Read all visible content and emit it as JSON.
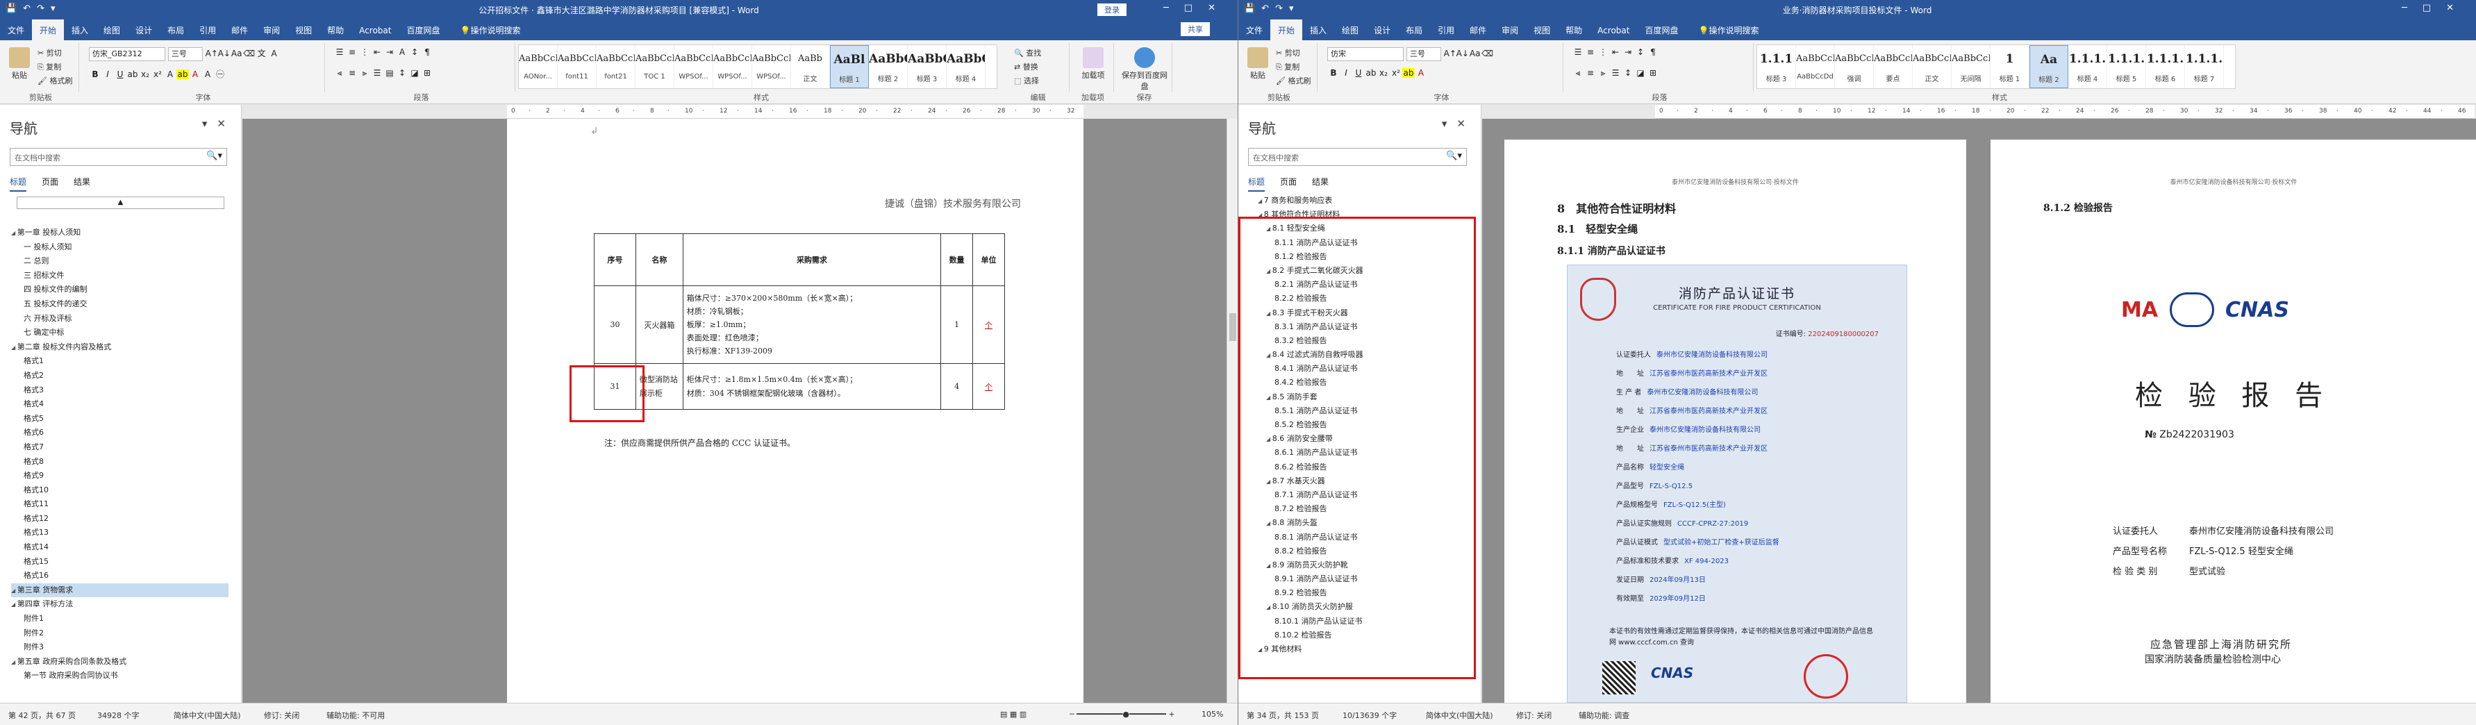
{
  "left": {
    "title": "公开招标文件 · 鑫锋市大洼区潞路中学消防器材采购项目 [兼容模式] - Word",
    "login": "登录",
    "tabs": [
      "文件",
      "开始",
      "插入",
      "绘图",
      "设计",
      "布局",
      "引用",
      "邮件",
      "审阅",
      "视图",
      "帮助",
      "Acrobat",
      "百度网盘"
    ],
    "tell_me": "操作说明搜索",
    "share": "共享",
    "font_name": "仿宋_GB2312",
    "font_size": "三号",
    "paste_label": "粘贴",
    "cut": "剪切",
    "copy": "复制",
    "format_painter": "格式刷",
    "group_clipboard": "剪贴板",
    "group_font": "字体",
    "group_paragraph": "段落",
    "group_styles": "样式",
    "group_edit": "编辑",
    "group_addin": "加载项",
    "group_save": "保存",
    "find": "查找",
    "replace": "替换",
    "select": "选择",
    "acrobat_sign": "加载项",
    "save_baidu": "保存到百度网盘",
    "styles": [
      {
        "pv": "AaBbCcDd",
        "nm": "AONor..."
      },
      {
        "pv": "AaBbCcDd",
        "nm": "font11"
      },
      {
        "pv": "AaBbCcDd",
        "nm": "font21"
      },
      {
        "pv": "AaBbCcDd",
        "nm": "TOC 1"
      },
      {
        "pv": "AaBbCcDd",
        "nm": "WPSOf..."
      },
      {
        "pv": "AaBbCcDd",
        "nm": "WPSOf..."
      },
      {
        "pv": "AaBbCcDd",
        "nm": "WPSOf..."
      },
      {
        "pv": "AaBb",
        "nm": "正文"
      },
      {
        "pv": "AaBl",
        "nm": "标题 1"
      },
      {
        "pv": "AaBbC",
        "nm": "标题 2"
      },
      {
        "pv": "AaBbC",
        "nm": "标题 3"
      },
      {
        "pv": "AaBbC",
        "nm": "标题 4"
      }
    ],
    "nav": {
      "title": "导航",
      "search_placeholder": "在文档中搜索",
      "tabs": [
        "标题",
        "页面",
        "结果"
      ],
      "items": [
        {
          "t": "第一章 投标人须知",
          "lv": 0
        },
        {
          "t": "一 投标人须知",
          "lv": 1
        },
        {
          "t": "二 总则",
          "lv": 1
        },
        {
          "t": "三 招标文件",
          "lv": 1
        },
        {
          "t": "四 投标文件的编制",
          "lv": 1
        },
        {
          "t": "五 投标文件的递交",
          "lv": 1
        },
        {
          "t": "六 开标及评标",
          "lv": 1
        },
        {
          "t": "七 确定中标",
          "lv": 1
        },
        {
          "t": "第二章 投标文件内容及格式",
          "lv": 0
        },
        {
          "t": "格式1",
          "lv": 1
        },
        {
          "t": "格式2",
          "lv": 1
        },
        {
          "t": "格式3",
          "lv": 1
        },
        {
          "t": "格式4",
          "lv": 1
        },
        {
          "t": "格式5",
          "lv": 1
        },
        {
          "t": "格式6",
          "lv": 1
        },
        {
          "t": "格式7",
          "lv": 1
        },
        {
          "t": "格式8",
          "lv": 1
        },
        {
          "t": "格式9",
          "lv": 1
        },
        {
          "t": "格式10",
          "lv": 1
        },
        {
          "t": "格式11",
          "lv": 1
        },
        {
          "t": "格式12",
          "lv": 1
        },
        {
          "t": "格式13",
          "lv": 1
        },
        {
          "t": "格式14",
          "lv": 1
        },
        {
          "t": "格式15",
          "lv": 1
        },
        {
          "t": "格式16",
          "lv": 1
        },
        {
          "t": "第三章 货物需求",
          "lv": 0,
          "sel": true
        },
        {
          "t": "第四章 评标方法",
          "lv": 0
        },
        {
          "t": "附件1",
          "lv": 1
        },
        {
          "t": "附件2",
          "lv": 1
        },
        {
          "t": "附件3",
          "lv": 1
        },
        {
          "t": "第五章 政府采购合同条款及格式",
          "lv": 0
        },
        {
          "t": "第一节 政府采购合同协议书",
          "lv": 1
        }
      ]
    },
    "doc": {
      "company": "捷诚（盘锦）技术服务有限公司",
      "headers": [
        "序号",
        "名称",
        "采购需求",
        "数量",
        "单位"
      ],
      "rows": [
        {
          "no": "30",
          "name": "灭火器箱",
          "req": [
            "箱体尺寸：≥370×200×580mm（长×宽×高）；",
            "材质：冷轧钢板；",
            "板厚：≥1.0mm；",
            "表面处理：红色喷漆；",
            "执行标准：XF139-2009"
          ],
          "qty": "1",
          "unit": "个"
        },
        {
          "no": "31",
          "name": "微型消防站展示柜",
          "req": [
            "柜体尺寸：≥1.8m×1.5m×0.4m（长×宽×高）；",
            "材质：304 不锈钢框架配钢化玻璃（含器材）。"
          ],
          "qty": "4",
          "unit": "个"
        }
      ],
      "note": "注：供应商需提供所供产品合格的 CCC 认证证书。"
    },
    "status": {
      "page": "第 42 页，共 67 页",
      "words": "34928 个字",
      "lang": "简体中文(中国大陆)",
      "track": "修订: 关闭",
      "access": "辅助功能: 不可用",
      "zoom": "105%"
    }
  },
  "right": {
    "title": "业务·消防器材采购项目投标文件 - Word",
    "tabs": [
      "文件",
      "开始",
      "插入",
      "绘图",
      "设计",
      "布局",
      "引用",
      "邮件",
      "审阅",
      "视图",
      "帮助",
      "Acrobat",
      "百度网盘"
    ],
    "tell_me": "操作说明搜索",
    "font_name": "仿宋",
    "font_size": "三号",
    "styles": [
      {
        "pv": "1.1.1",
        "nm": "标题 3"
      },
      {
        "pv": "AaBbCcDd",
        "nm": "AaBbCcDd"
      },
      {
        "pv": "AaBbCcDd",
        "nm": "强调"
      },
      {
        "pv": "AaBbCcDd",
        "nm": "要点"
      },
      {
        "pv": "AaBbCcDd",
        "nm": "正文"
      },
      {
        "pv": "AaBbCcDd",
        "nm": "无间隔"
      },
      {
        "pv": "1",
        "nm": "标题 1"
      },
      {
        "pv": "Aa",
        "nm": "标题 2"
      },
      {
        "pv": "1.1.1.",
        "nm": "标题 4"
      },
      {
        "pv": "1.1.1.",
        "nm": "标题 5"
      },
      {
        "pv": "1.1.1.",
        "nm": "标题 6"
      },
      {
        "pv": "1.1.1.",
        "nm": "标题 7"
      }
    ],
    "nav": {
      "title": "导航",
      "search_placeholder": "在文档中搜索",
      "tabs": [
        "标题",
        "页面",
        "结果"
      ],
      "items": [
        {
          "t": "7 商务和服务响应表",
          "lv": 1
        },
        {
          "t": "8 其他符合性证明材料",
          "lv": 1
        },
        {
          "t": "8.1 轻型安全绳",
          "lv": 2
        },
        {
          "t": "8.1.1 消防产品认证证书",
          "lv": 3
        },
        {
          "t": "8.1.2 检验报告",
          "lv": 3
        },
        {
          "t": "8.2 手提式二氧化碳灭火器",
          "lv": 2
        },
        {
          "t": "8.2.1 消防产品认证证书",
          "lv": 3
        },
        {
          "t": "8.2.2 检验报告",
          "lv": 3
        },
        {
          "t": "8.3 手提式干粉灭火器",
          "lv": 2
        },
        {
          "t": "8.3.1 消防产品认证证书",
          "lv": 3
        },
        {
          "t": "8.3.2 检验报告",
          "lv": 3
        },
        {
          "t": "8.4 过滤式消防自救呼吸器",
          "lv": 2
        },
        {
          "t": "8.4.1 消防产品认证证书",
          "lv": 3
        },
        {
          "t": "8.4.2 检验报告",
          "lv": 3
        },
        {
          "t": "8.5 消防手套",
          "lv": 2
        },
        {
          "t": "8.5.1 消防产品认证证书",
          "lv": 3
        },
        {
          "t": "8.5.2 检验报告",
          "lv": 3
        },
        {
          "t": "8.6 消防安全腰带",
          "lv": 2
        },
        {
          "t": "8.6.1 消防产品认证证书",
          "lv": 3
        },
        {
          "t": "8.6.2 检验报告",
          "lv": 3
        },
        {
          "t": "8.7 水基灭火器",
          "lv": 2
        },
        {
          "t": "8.7.1 消防产品认证证书",
          "lv": 3
        },
        {
          "t": "8.7.2 检验报告",
          "lv": 3
        },
        {
          "t": "8.8 消防头盔",
          "lv": 2
        },
        {
          "t": "8.8.1 消防产品认证证书",
          "lv": 3
        },
        {
          "t": "8.8.2 检验报告",
          "lv": 3
        },
        {
          "t": "8.9 消防员灭火防护靴",
          "lv": 2
        },
        {
          "t": "8.9.1 消防产品认证证书",
          "lv": 3
        },
        {
          "t": "8.9.2 检验报告",
          "lv": 3
        },
        {
          "t": "8.10 消防员灭火防护服",
          "lv": 2
        },
        {
          "t": "8.10.1 消防产品认证证书",
          "lv": 3
        },
        {
          "t": "8.10.2 检验报告",
          "lv": 3
        },
        {
          "t": "9 其他材料",
          "lv": 1
        }
      ]
    },
    "doc1": {
      "header": "泰州市亿安隆消防设备科技有限公司·投标文件",
      "h1": "8　其他符合性证明材料",
      "h2": "8.1　轻型安全绳",
      "h3": "8.1.1 消防产品认证证书",
      "cert_title": "消防产品认证证书",
      "cert_en": "CERTIFICATE FOR FIRE PRODUCT CERTIFICATION",
      "cert_no_label": "证书编号",
      "cert_no": "2202409180000207",
      "cert_rows": [
        {
          "k": "认证委托人",
          "v": "泰州市亿安隆消防设备科技有限公司"
        },
        {
          "k": "地　　址",
          "v": "江苏省泰州市医药高新技术产业开发区"
        },
        {
          "k": "生 产 者",
          "v": "泰州市亿安隆消防设备科技有限公司"
        },
        {
          "k": "地　　址",
          "v": "江苏省泰州市医药高新技术产业开发区"
        },
        {
          "k": "生产企业",
          "v": "泰州市亿安隆消防设备科技有限公司"
        },
        {
          "k": "地　　址",
          "v": "江苏省泰州市医药高新技术产业开发区"
        },
        {
          "k": "产品名称",
          "v": "轻型安全绳"
        },
        {
          "k": "产品型号",
          "v": "FZL-S-Q12.5"
        },
        {
          "k": "产品规格型号",
          "v": "FZL-S-Q12.5(主型)"
        },
        {
          "k": "产品认证实施规则",
          "v": "CCCF-CPRZ-27:2019"
        },
        {
          "k": "产品认证模式",
          "v": "型式试验+初始工厂检查+获证后监督"
        },
        {
          "k": "产品标准和技术要求",
          "v": "XF 494-2023"
        },
        {
          "k": "发证日期",
          "v": "2024年09月13日"
        },
        {
          "k": "有效期至",
          "v": "2029年09月12日"
        }
      ],
      "cert_foot": "本证书的有效性需通过定期监督获得保持，本证书的相关信息可通过中国消防产品信息网 www.cccf.com.cn 查询",
      "cnas": "CNAS"
    },
    "doc2": {
      "header": "泰州市亿安隆消防设备科技有限公司·投标文件",
      "h3": "8.1.2 检验报告",
      "logo_ma": "MA",
      "logo_cnas": "CNAS",
      "report_title": "检 验 报 告",
      "report_no_label": "№",
      "report_no": "Zb2422031903",
      "fields": [
        {
          "k": "认证委托人",
          "v": "泰州市亿安隆消防设备科技有限公司"
        },
        {
          "k": "产品型号名称",
          "v": "FZL-S-Q12.5 轻型安全绳"
        },
        {
          "k": "检 验 类 别",
          "v": "型式试验"
        }
      ],
      "org1": "应急管理部上海消防研究所",
      "org2": "国家消防装备质量检验检测中心"
    },
    "status": {
      "page": "第 34 页，共 153 页",
      "words": "10/13639 个字",
      "lang": "简体中文(中国大陆)",
      "track": "修订: 关闭",
      "access": "辅助功能: 调查"
    }
  },
  "colors": {
    "accent": "#2b579a",
    "highlight": "#d11111",
    "selected": "#c7dcf1"
  }
}
